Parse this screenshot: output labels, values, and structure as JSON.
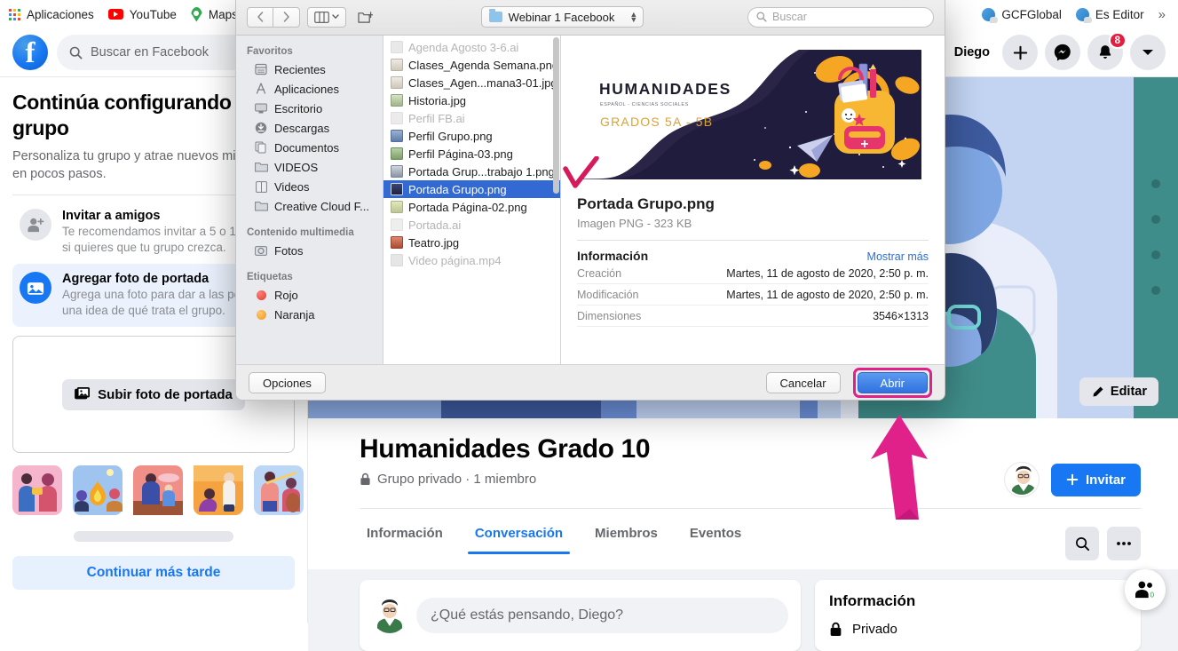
{
  "browser": {
    "bookmarks": [
      {
        "label": "Aplicaciones",
        "icon": "apps-grid-icon"
      },
      {
        "label": "YouTube",
        "icon": "youtube-icon"
      },
      {
        "label": "Maps",
        "icon": "maps-pin-icon"
      },
      {
        "label": "GCFGlobal",
        "icon": "globe-icon"
      },
      {
        "label": "Es Editor",
        "icon": "globe-icon"
      }
    ],
    "overflow_label": "»"
  },
  "facebook": {
    "topbar": {
      "logo": "facebook-logo",
      "search_placeholder": "Buscar en Facebook",
      "user_name": "Diego",
      "create_label": "+",
      "messenger_icon": "messenger-icon",
      "notifications_icon": "bell-icon",
      "notifications_count": "8",
      "account_icon": "chevron-down-icon"
    },
    "setup_panel": {
      "title": "Continúa configurando tu grupo",
      "subtitle": "Personaliza tu grupo y atrae nuevos miembros en pocos pasos.",
      "steps": [
        {
          "title": "Invitar a amigos",
          "desc": "Te recomendamos invitar a 5 o 10 amigos si quieres que tu grupo crezca.",
          "icon": "add-person-icon",
          "active": false
        },
        {
          "title": "Agregar foto de portada",
          "desc": "Agrega una foto para dar a las personas una idea de qué trata el grupo.",
          "icon": "photo-icon",
          "active": true
        }
      ],
      "upload_button": "Subir foto de portada",
      "upload_icon": "photo-stack-icon",
      "later_button": "Continuar más tarde"
    },
    "cover": {
      "edit_button": "Editar",
      "edit_icon": "pencil-icon"
    },
    "group": {
      "name": "Humanidades Grado 10",
      "privacy_icon": "lock-icon",
      "meta": "Grupo privado · 1 miembro",
      "invite_button": "Invitar",
      "invite_icon": "plus-icon",
      "tabs": [
        {
          "label": "Información",
          "selected": false
        },
        {
          "label": "Conversación",
          "selected": true
        },
        {
          "label": "Miembros",
          "selected": false
        },
        {
          "label": "Eventos",
          "selected": false
        }
      ],
      "search_icon": "search-icon",
      "more_icon": "ellipsis-icon"
    },
    "content": {
      "composer_placeholder": "¿Qué estás pensando, Diego?",
      "info_card_title": "Información",
      "info_privacy": "Privado",
      "info_privacy_icon": "lock-icon",
      "chat_fab_icon": "contacts-icon",
      "chat_fab_count": "0"
    }
  },
  "file_dialog": {
    "toolbar": {
      "back_icon": "chevron-left-icon",
      "forward_icon": "chevron-right-icon",
      "view_icon": "column-view-icon",
      "view_chevron": "chevron-down-icon",
      "new_folder_icon": "new-folder-icon",
      "path_label": "Webinar 1 Facebook",
      "path_folder_icon": "folder-icon",
      "path_stepper_icon": "up-down-stepper-icon",
      "search_placeholder": "Buscar",
      "search_icon": "search-icon"
    },
    "sidebar": [
      {
        "header": "Favoritos",
        "items": [
          {
            "label": "Recientes",
            "icon": "recents-icon"
          },
          {
            "label": "Aplicaciones",
            "icon": "applications-icon"
          },
          {
            "label": "Escritorio",
            "icon": "desktop-icon"
          },
          {
            "label": "Descargas",
            "icon": "downloads-icon"
          },
          {
            "label": "Documentos",
            "icon": "documents-icon"
          },
          {
            "label": "VIDEOS",
            "icon": "folder-icon"
          },
          {
            "label": "Videos",
            "icon": "movies-icon"
          },
          {
            "label": "Creative Cloud F...",
            "icon": "folder-icon"
          }
        ]
      },
      {
        "header": "Contenido multimedia",
        "items": [
          {
            "label": "Fotos",
            "icon": "photos-icon"
          }
        ]
      },
      {
        "header": "Etiquetas",
        "items": [
          {
            "label": "Rojo",
            "icon": "tag-dot",
            "color": "#ee4a44"
          },
          {
            "label": "Naranja",
            "icon": "tag-dot",
            "color": "#f5a623"
          }
        ]
      }
    ],
    "files": [
      {
        "name": "Agenda Agosto 3-6.ai",
        "state": "dimmed",
        "color": "#d8d8d8"
      },
      {
        "name": "Clases_Agenda Semana.png",
        "state": "normal",
        "color": "#c9c3bb"
      },
      {
        "name": "Clases_Agen...mana3-01.jpg",
        "state": "normal",
        "color": "#c9c3bb"
      },
      {
        "name": "Historia.jpg",
        "state": "normal",
        "color": "#b7c6a6"
      },
      {
        "name": "Perfil FB.ai",
        "state": "dimmed",
        "color": "#e0dcd5"
      },
      {
        "name": "Perfil Grupo.png",
        "state": "normal",
        "color": "#7b94b8"
      },
      {
        "name": "Perfil Página-03.png",
        "state": "normal",
        "color": "#8fb37c"
      },
      {
        "name": "Portada Grup...trabajo 1.png",
        "state": "normal",
        "color": "#9aa5b4"
      },
      {
        "name": "Portada Grupo.png",
        "state": "selected",
        "color": "#2b3358"
      },
      {
        "name": "Portada Página-02.png",
        "state": "normal",
        "color": "#cfd4a8"
      },
      {
        "name": "Portada.ai",
        "state": "dimmed",
        "color": "#e3e0da"
      },
      {
        "name": "Teatro.jpg",
        "state": "normal",
        "color": "#c4614d"
      },
      {
        "name": "Video página.mp4",
        "state": "dimmed",
        "color": "#dedede"
      }
    ],
    "preview": {
      "thumbnail": {
        "heading": "HUMANIDADES",
        "subheading": "ESPAÑOL - CIENCIAS SOCIALES",
        "grades": "GRADOS 5A - 5B"
      },
      "file_name": "Portada Grupo.png",
      "kind": "Imagen PNG - 323 KB",
      "info_heading": "Información",
      "show_more": "Mostrar más",
      "metadata": [
        {
          "key": "Creación",
          "value": "Martes, 11 de agosto de 2020, 2:50 p. m."
        },
        {
          "key": "Modificación",
          "value": "Martes, 11 de agosto de 2020, 2:50 p. m."
        },
        {
          "key": "Dimensiones",
          "value": "3546×1313"
        }
      ]
    },
    "footer": {
      "options_label": "Opciones",
      "cancel_label": "Cancelar",
      "open_label": "Abrir"
    }
  },
  "annotations": {
    "checkmark_color": "#d61a5c",
    "arrow_color": "#e0218a",
    "highlight_color": "#e0218a"
  }
}
